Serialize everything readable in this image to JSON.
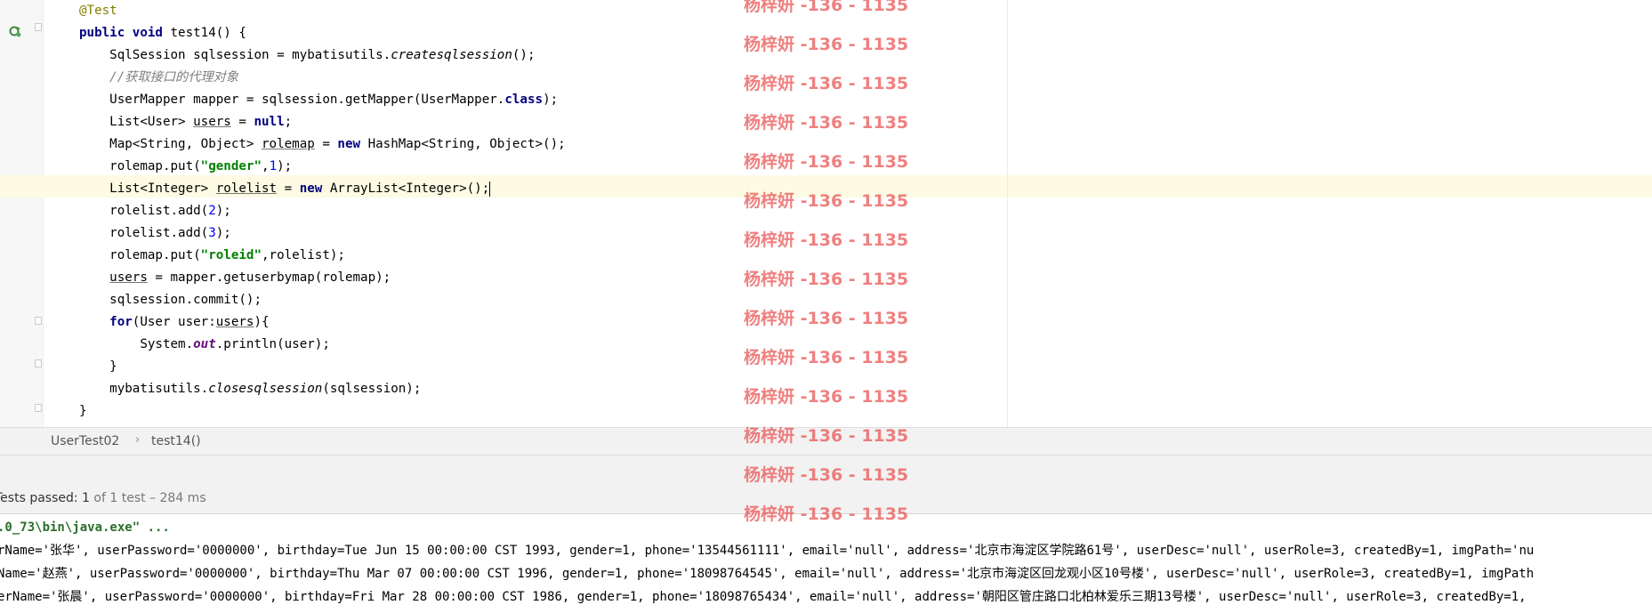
{
  "editor": {
    "lines": [
      [
        {
          "t": "@Test",
          "c": "ann"
        }
      ],
      [
        {
          "t": "public",
          "c": "kw"
        },
        {
          "t": " "
        },
        {
          "t": "void",
          "c": "kw"
        },
        {
          "t": " test14() {"
        }
      ],
      [
        {
          "t": "    SqlSession sqlsession = mybatisutils."
        },
        {
          "t": "createsqlsession",
          "c": "it"
        },
        {
          "t": "();"
        }
      ],
      [
        {
          "t": "    "
        },
        {
          "t": "//获取接口的代理对象",
          "c": "cmt"
        }
      ],
      [
        {
          "t": "    UserMapper mapper = sqlsession.getMapper(UserMapper."
        },
        {
          "t": "class",
          "c": "kw"
        },
        {
          "t": ");"
        }
      ],
      [
        {
          "t": "    List<User> "
        },
        {
          "t": "users",
          "c": "ul"
        },
        {
          "t": " = "
        },
        {
          "t": "null",
          "c": "kw"
        },
        {
          "t": ";"
        }
      ],
      [
        {
          "t": "    Map<String, Object> "
        },
        {
          "t": "rolemap",
          "c": "ul"
        },
        {
          "t": " = "
        },
        {
          "t": "new",
          "c": "kw"
        },
        {
          "t": " HashMap<String, Object>();"
        }
      ],
      [
        {
          "t": "    rolemap.put("
        },
        {
          "t": "\"gender\"",
          "c": "str"
        },
        {
          "t": ","
        },
        {
          "t": "1",
          "c": "num"
        },
        {
          "t": ");"
        }
      ],
      [
        {
          "t": "    List<Integer> "
        },
        {
          "t": "rolelist",
          "c": "ul"
        },
        {
          "t": " = "
        },
        {
          "t": "new",
          "c": "kw"
        },
        {
          "t": " ArrayList<Integer>();"
        },
        {
          "t": "",
          "c": "caret"
        }
      ],
      [
        {
          "t": "    rolelist.add("
        },
        {
          "t": "2",
          "c": "num"
        },
        {
          "t": ");"
        }
      ],
      [
        {
          "t": "    rolelist.add("
        },
        {
          "t": "3",
          "c": "num"
        },
        {
          "t": ");"
        }
      ],
      [
        {
          "t": "    rolemap.put("
        },
        {
          "t": "\"roleid\"",
          "c": "str"
        },
        {
          "t": ",rolelist);"
        }
      ],
      [
        {
          "t": "    "
        },
        {
          "t": "users",
          "c": "ul"
        },
        {
          "t": " = mapper.getuserbymap(rolemap);"
        }
      ],
      [
        {
          "t": "    sqlsession.commit();"
        }
      ],
      [
        {
          "t": "    "
        },
        {
          "t": "for",
          "c": "kw"
        },
        {
          "t": "(User user:"
        },
        {
          "t": "users",
          "c": "ul"
        },
        {
          "t": "){"
        }
      ],
      [
        {
          "t": "        System."
        },
        {
          "t": "out",
          "c": "fld"
        },
        {
          "t": ".println(user);"
        }
      ],
      [
        {
          "t": "    }"
        }
      ],
      [
        {
          "t": "    mybatisutils."
        },
        {
          "t": "closesqlsession",
          "c": "it"
        },
        {
          "t": "(sqlsession);"
        }
      ],
      [
        {
          "t": "}"
        }
      ]
    ],
    "icons": {
      "run": "rerun-test-icon",
      "fold": "fold-marker-icon"
    }
  },
  "breadcrumb": {
    "class_name": "UserTest02",
    "method_name": "test14()",
    "separator": "›"
  },
  "test_status": {
    "prefix": "Tests passed: ",
    "passed": "1",
    "suffix": " of 1 test – 284 ms"
  },
  "console": {
    "command": ".0_73\\bin\\java.exe\" ...",
    "lines": [
      "rName='张华', userPassword='0000000', birthday=Tue Jun 15 00:00:00 CST 1993, gender=1, phone='13544561111', email='null', address='北京市海淀区学院路61号', userDesc='null', userRole=3, createdBy=1, imgPath='nu",
      "Name='赵燕', userPassword='0000000', birthday=Thu Mar 07 00:00:00 CST 1996, gender=1, phone='18098764545', email='null', address='北京市海淀区回龙观小区10号楼', userDesc='null', userRole=3, createdBy=1, imgPath",
      "erName='张晨', userPassword='0000000', birthday=Fri Mar 28 00:00:00 CST 1986, gender=1, phone='18098765434', email='null', address='朝阳区管庄路口北柏林爱乐三期13号楼', userDesc='null', userRole=3, createdBy=1, "
    ]
  },
  "watermark": {
    "text": "杨梓妍 -136 - 1135",
    "color": "#ea5c5c"
  }
}
